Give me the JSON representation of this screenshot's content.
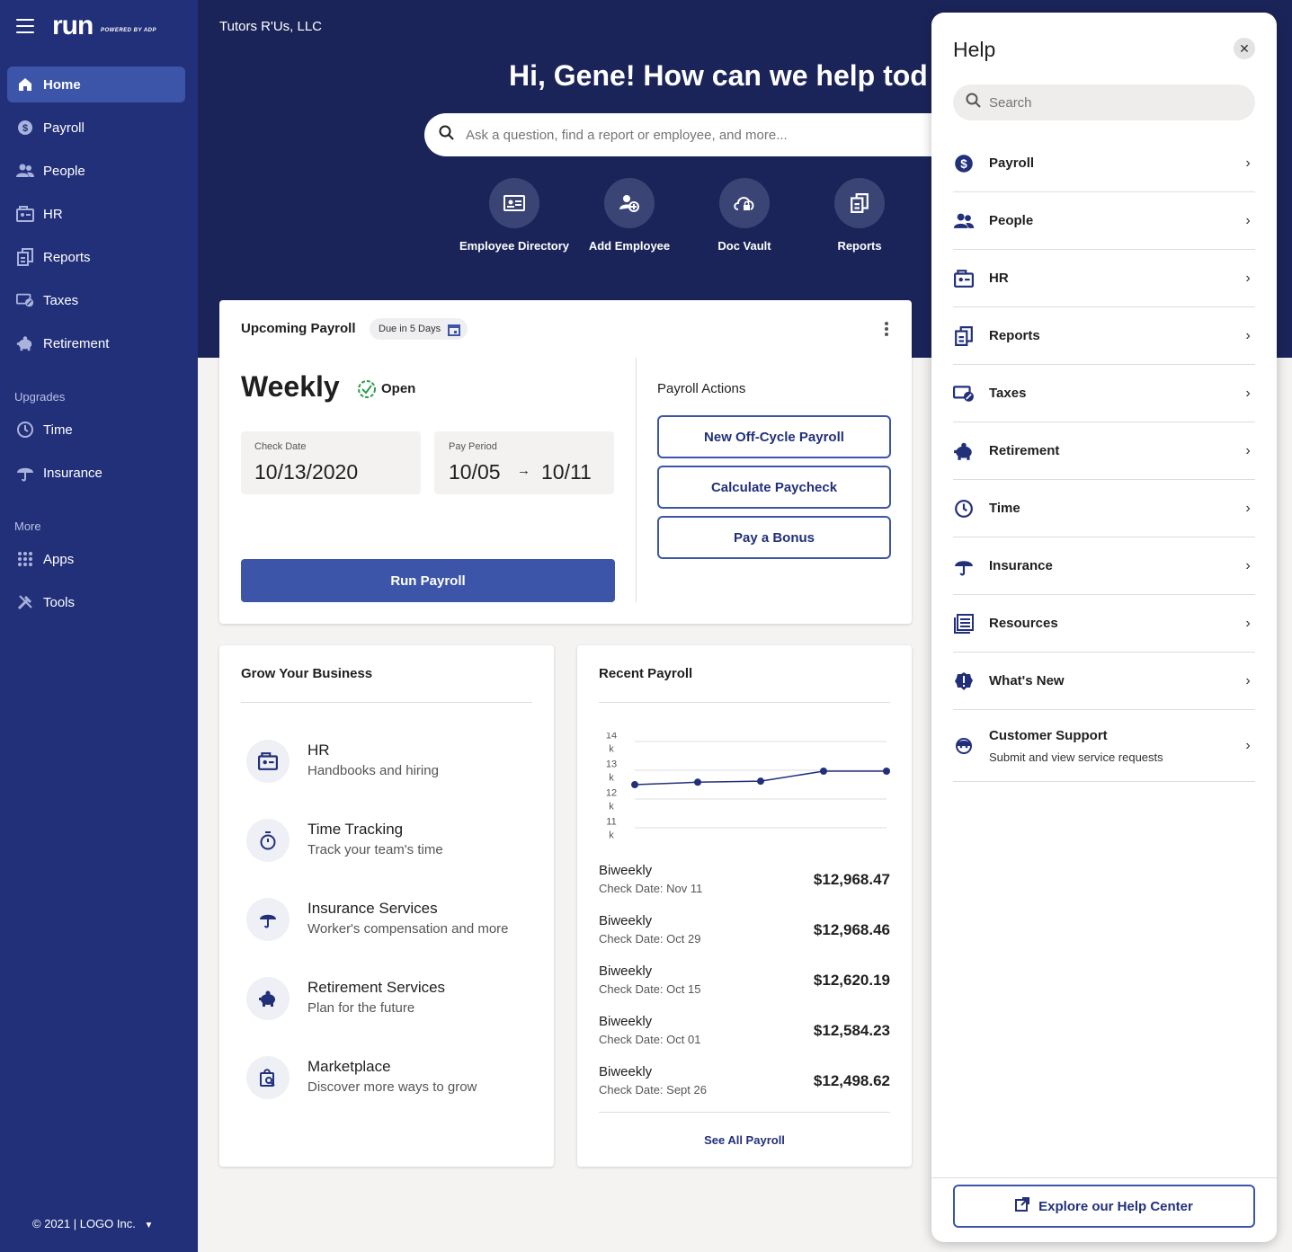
{
  "sidebar": {
    "logo": "run",
    "powered_by": "POWERED BY ADP",
    "items": [
      {
        "label": "Home",
        "icon": "home-icon"
      },
      {
        "label": "Payroll",
        "icon": "dollar-icon"
      },
      {
        "label": "People",
        "icon": "people-icon"
      },
      {
        "label": "HR",
        "icon": "hr-icon"
      },
      {
        "label": "Reports",
        "icon": "reports-icon"
      },
      {
        "label": "Taxes",
        "icon": "taxes-icon"
      },
      {
        "label": "Retirement",
        "icon": "piggy-bank-icon"
      }
    ],
    "upgrades_label": "Upgrades",
    "upgrades": [
      {
        "label": "Time",
        "icon": "clock-icon"
      },
      {
        "label": "Insurance",
        "icon": "umbrella-icon"
      }
    ],
    "more_label": "More",
    "more": [
      {
        "label": "Apps",
        "icon": "grid-icon"
      },
      {
        "label": "Tools",
        "icon": "tools-icon"
      }
    ],
    "copyright": "© 2021 | LOGO Inc."
  },
  "header": {
    "company": "Tutors R'Us, LLC",
    "greeting": "Hi, Gene! How can we help tod",
    "search_placeholder": "Ask a question, find a report or employee, and more...",
    "quick_actions": [
      {
        "label": "Employee Directory",
        "icon": "id-card-icon"
      },
      {
        "label": "Add Employee",
        "icon": "add-person-icon"
      },
      {
        "label": "Doc Vault",
        "icon": "cloud-lock-icon"
      },
      {
        "label": "Reports",
        "icon": "reports-icon"
      }
    ]
  },
  "upcoming_payroll": {
    "title": "Upcoming Payroll",
    "due_badge": "Due in 5 Days",
    "frequency": "Weekly",
    "status": "Open",
    "check_date_label": "Check Date",
    "check_date": "10/13/2020",
    "pay_period_label": "Pay Period",
    "pay_period_start": "10/05",
    "pay_period_end": "10/11",
    "run_button": "Run Payroll",
    "actions_title": "Payroll Actions",
    "actions": [
      "New Off-Cycle Payroll",
      "Calculate Paycheck",
      "Pay a Bonus"
    ]
  },
  "grow": {
    "title": "Grow Your Business",
    "items": [
      {
        "title": "HR",
        "subtitle": "Handbooks and hiring",
        "icon": "hr-icon"
      },
      {
        "title": "Time Tracking",
        "subtitle": "Track your team's time",
        "icon": "stopwatch-icon"
      },
      {
        "title": "Insurance Services",
        "subtitle": "Worker's compensation and more",
        "icon": "umbrella-icon"
      },
      {
        "title": "Retirement Services",
        "subtitle": "Plan for the future",
        "icon": "piggy-bank-icon"
      },
      {
        "title": "Marketplace",
        "subtitle": "Discover more ways to grow",
        "icon": "marketplace-icon"
      }
    ]
  },
  "recent_payroll": {
    "title": "Recent Payroll",
    "rows": [
      {
        "type": "Biweekly",
        "date": "Check Date: Nov 11",
        "amount": "$12,968.47"
      },
      {
        "type": "Biweekly",
        "date": "Check Date: Oct 29",
        "amount": "$12,968.46"
      },
      {
        "type": "Biweekly",
        "date": "Check Date: Oct 15",
        "amount": "$12,620.19"
      },
      {
        "type": "Biweekly",
        "date": "Check Date: Oct 01",
        "amount": "$12,584.23"
      },
      {
        "type": "Biweekly",
        "date": "Check Date: Sept 26",
        "amount": "$12,498.62"
      }
    ],
    "see_all": "See All Payroll"
  },
  "chart_data": {
    "type": "line",
    "y_ticks": [
      "14 k",
      "13 k",
      "12 k",
      "11 k"
    ],
    "ylim": [
      11000,
      14000
    ],
    "values": [
      12498.62,
      12584.23,
      12620.19,
      12968.46,
      12968.47
    ],
    "grid": true,
    "color": "#22307a"
  },
  "help": {
    "title": "Help",
    "search_placeholder": "Search",
    "items": [
      {
        "label": "Payroll",
        "icon": "dollar-icon"
      },
      {
        "label": "People",
        "icon": "people-icon"
      },
      {
        "label": "HR",
        "icon": "hr-icon"
      },
      {
        "label": "Reports",
        "icon": "reports-icon"
      },
      {
        "label": "Taxes",
        "icon": "taxes-icon"
      },
      {
        "label": "Retirement",
        "icon": "piggy-bank-icon"
      },
      {
        "label": "Time",
        "icon": "clock-icon"
      },
      {
        "label": "Insurance",
        "icon": "umbrella-icon"
      },
      {
        "label": "Resources",
        "icon": "book-icon"
      },
      {
        "label": "What's New",
        "icon": "alert-badge-icon"
      }
    ],
    "support_title": "Customer Support",
    "support_subtitle": "Submit and view service requests",
    "explore": "Explore our Help Center"
  },
  "colors": {
    "sidebar": "#22307a",
    "hero": "#1b2459",
    "primary": "#3d55a8"
  }
}
